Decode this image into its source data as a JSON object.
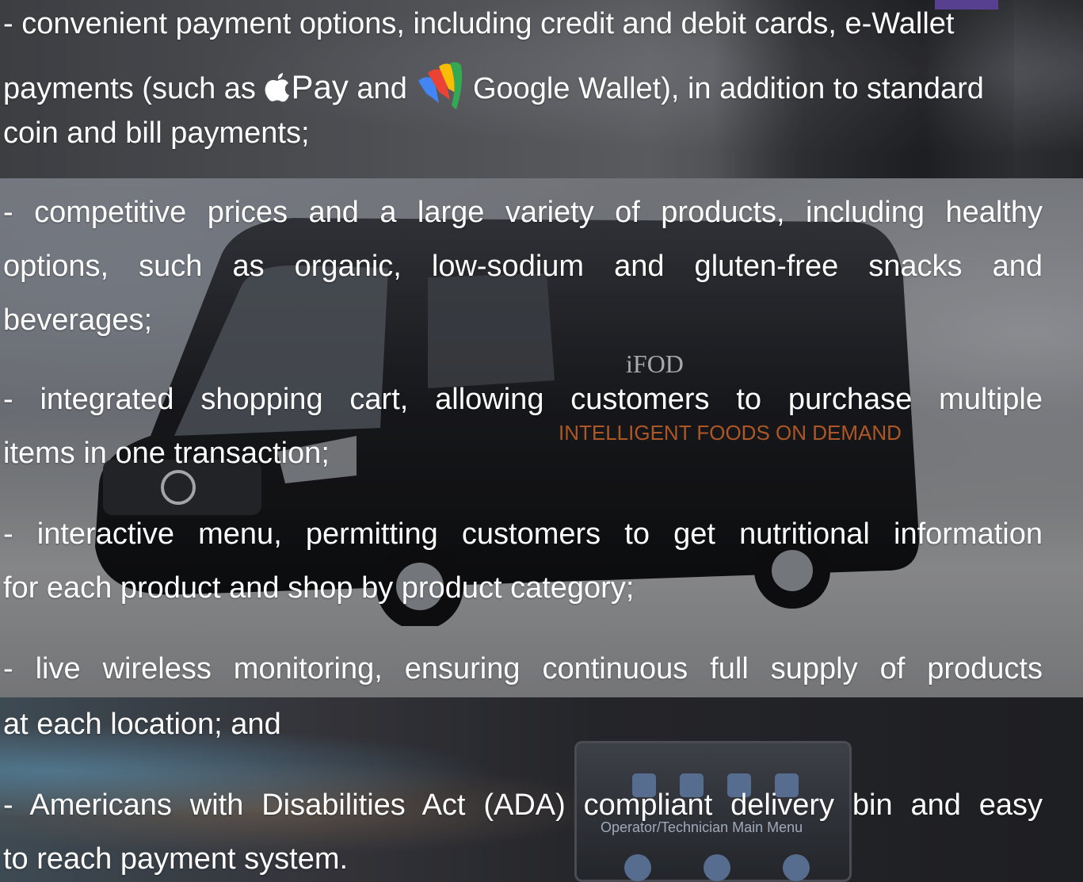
{
  "items": [
    {
      "lines": [
        "- convenient payment options, including credit and debit cards, e-Wallet",
        "coin and bill payments;"
      ],
      "payments_line": {
        "before": "payments (such as",
        "apple_pay": "Pay",
        "and": "and",
        "google_wallet": "Google Wallet",
        "after": "), in addition to standard"
      }
    },
    {
      "lines": [
        "- competitive prices and a large variety of products, including healthy",
        "options, such as organic, low-sodium and gluten-free snacks and",
        "beverages;"
      ]
    },
    {
      "lines": [
        "- integrated shopping cart, allowing customers to purchase multiple",
        "items in one transaction;"
      ]
    },
    {
      "lines": [
        "- interactive menu, permitting customers to get nutritional information",
        "for each product and shop by product category;"
      ]
    },
    {
      "lines": [
        "- live wireless monitoring, ensuring continuous full supply of products",
        "at each location; and"
      ]
    },
    {
      "lines": [
        "- Americans with Disabilities Act (ADA) compliant delivery bin and easy",
        "to reach payment system."
      ]
    }
  ],
  "van_text": {
    "logo": "iFOD",
    "slogan": "INTELLIGENT FOODS ON DEMAND"
  },
  "screen": {
    "menu_label": "Operator/Technician Main Menu"
  },
  "icons": {
    "apple": "apple-logo-icon",
    "google_wallet": "google-wallet-logo-icon"
  },
  "colors": {
    "text": "#ffffff",
    "wallet_blue": "#4285f4",
    "wallet_red": "#ea4335",
    "wallet_yellow": "#fbbc05",
    "wallet_green": "#34a853"
  }
}
